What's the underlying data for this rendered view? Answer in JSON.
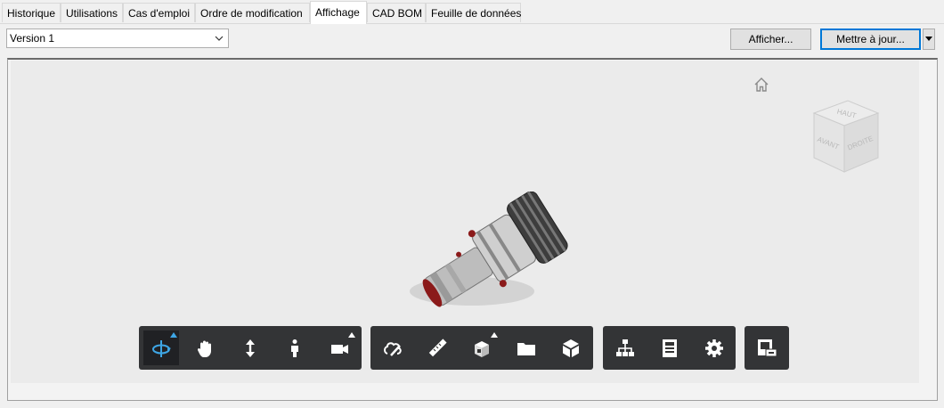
{
  "tabs": [
    "Historique",
    "Utilisations",
    "Cas d'emploi",
    "Ordre de modification",
    "Affichage",
    "CAD BOM",
    "Feuille de données"
  ],
  "active_tab": "Affichage",
  "version": {
    "selected": "Version 1"
  },
  "buttons": {
    "show": "Afficher...",
    "update": "Mettre à jour..."
  },
  "viewcube": {
    "top": "HAUT",
    "front": "AVANT",
    "right": "DROITE"
  },
  "toolbar": {
    "groups": [
      [
        "orbit-icon",
        "pan-icon",
        "zoom-icon",
        "first-person-icon",
        "camera-icon"
      ],
      [
        "markup-icon",
        "measure-icon",
        "section-icon",
        "explode-icon",
        "cube-icon"
      ],
      [
        "model-browser-icon",
        "properties-icon",
        "settings-icon"
      ],
      [
        "print-icon"
      ]
    ]
  },
  "colors": {
    "accent": "#0078d7",
    "toolbar_bg": "#333436",
    "active_icon": "#3ea6e5"
  }
}
